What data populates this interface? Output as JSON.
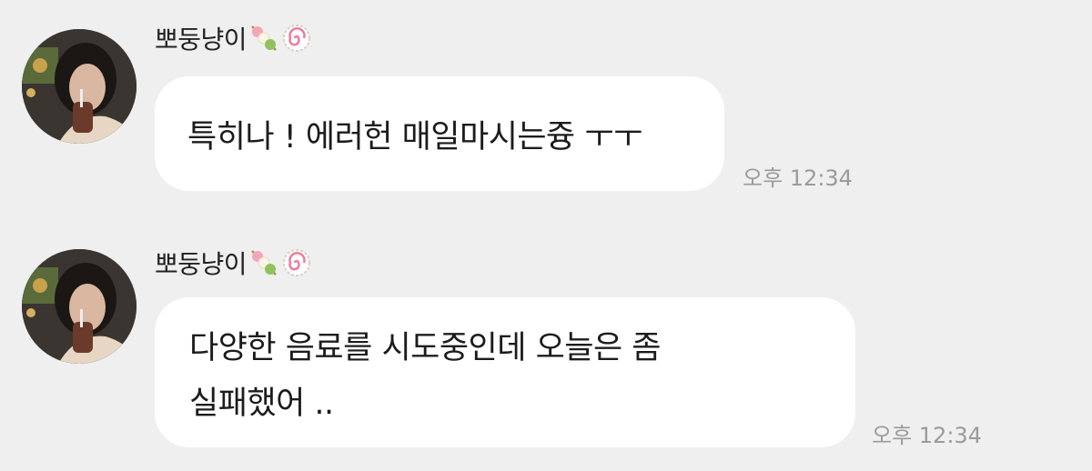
{
  "messages": [
    {
      "sender": "뽀둥냥이",
      "lines": [
        "특히나 ! 에러헌 매일마시는즁 ㅜㅜ"
      ],
      "time": "오후 12:34"
    },
    {
      "sender": "뽀둥냥이",
      "lines": [
        "다양한 음료를 시도중인데 오늘은 좀",
        "실패했어 .."
      ],
      "time": "오후 12:34"
    }
  ],
  "icons": {
    "name_emoji_1": "dango-icon",
    "name_emoji_2": "narutomaki-icon"
  },
  "colors": {
    "background": "#efefef",
    "bubble": "#ffffff",
    "timestamp": "#9a9a9a"
  }
}
